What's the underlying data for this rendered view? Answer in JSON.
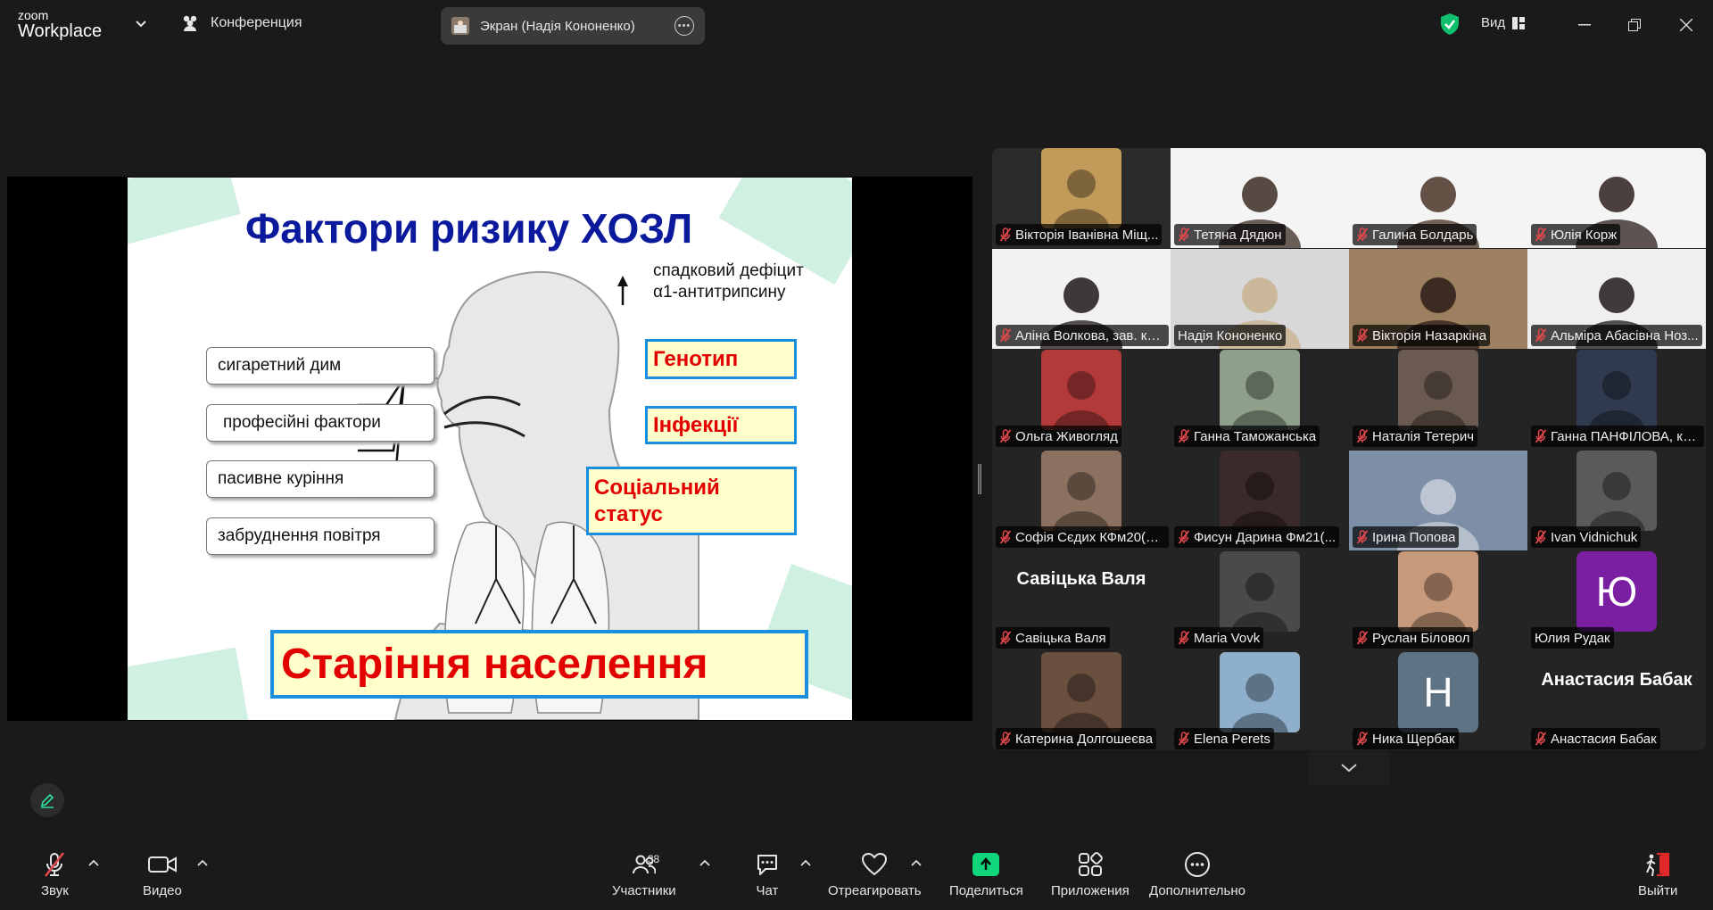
{
  "titlebar": {
    "logo_top": "zoom",
    "logo_bottom": "Workplace",
    "meeting_label": "Конференция",
    "screen_share_label": "Экран (Надія Кононенко)",
    "view_label": "Вид"
  },
  "slide": {
    "title": "Фактори ризику ХОЗЛ",
    "genetic_line1": "спадковий дефіцит",
    "genetic_line2": "α1-антитрипсину",
    "factors": [
      "сигаретний дим",
      "професійні фактори",
      "пасивне куріння",
      "забруднення повітря"
    ],
    "genotype": "Генотип",
    "infections": "Інфекції",
    "social_line1": "Соціальний",
    "social_line2": "статус",
    "aging": "Старіння населення"
  },
  "participants": [
    {
      "name": "Вікторія Іванівна Міщ..."
    },
    {
      "name": "Тетяна Дядюн"
    },
    {
      "name": "Галина Болдарь"
    },
    {
      "name": "Юлія Корж"
    },
    {
      "name": "Аліна Волкова, зав. ка..."
    },
    {
      "name": "Надія Кононенко"
    },
    {
      "name": "Вікторія Назаркіна"
    },
    {
      "name": "Альміра Абасівна Ноз..."
    },
    {
      "name": "Ольга Живогляд"
    },
    {
      "name": "Ганна Таможанська"
    },
    {
      "name": "Наталія Тетерич"
    },
    {
      "name": "Ганна ПАНФІЛОВА, ка..."
    },
    {
      "name": "Софія Сєдих КФм20(4,..."
    },
    {
      "name": "Фисун Дарина Фм21(..."
    },
    {
      "name": "Ірина Попова"
    },
    {
      "name": "Ivan Vidnichuk"
    },
    {
      "name": "Савіцька Валя",
      "avatar_text": "Савіцька Валя"
    },
    {
      "name": "Maria Vovk"
    },
    {
      "name": "Руслан Біловол"
    },
    {
      "name": "Юлия Рудак",
      "avatar_letter": "Ю"
    },
    {
      "name": "Катерина Долгошеєва"
    },
    {
      "name": "Elena Perets"
    },
    {
      "name": "Ника Щербак",
      "avatar_letter": "Н"
    },
    {
      "name": "Анастасия Бабак",
      "avatar_text": "Анастасия Бабак"
    }
  ],
  "toolbar": {
    "audio": "Звук",
    "video": "Видео",
    "participants": "Участники",
    "participants_count": "38",
    "chat": "Чат",
    "react": "Отреагировать",
    "share": "Поделиться",
    "apps": "Приложения",
    "more": "Дополнительно",
    "leave": "Выйти"
  },
  "colors": {
    "accent_green": "#0fd67a",
    "active_speaker": "#2ee59d",
    "mute_red": "#e5484d",
    "leave_red": "#e02828"
  }
}
